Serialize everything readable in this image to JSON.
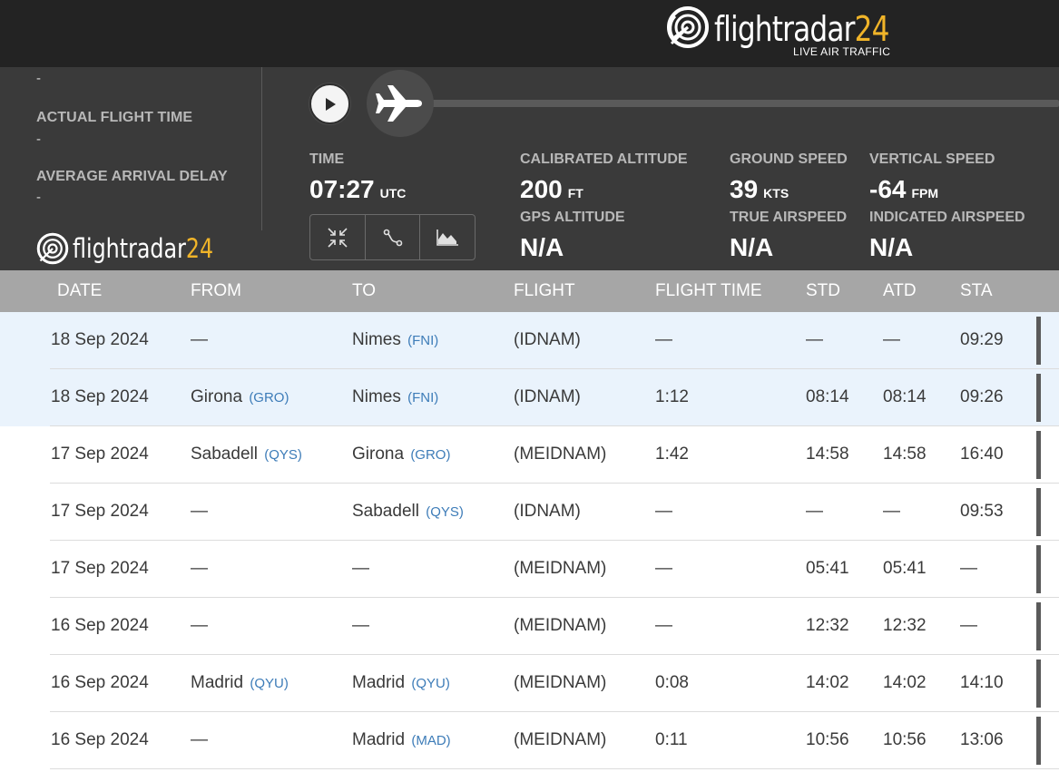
{
  "brand": {
    "name_text": "flightradar",
    "name_number": "24",
    "tagline": "LIVE AIR TRAFFIC"
  },
  "summary": {
    "top_value": "-",
    "actual_flight_time_label": "ACTUAL FLIGHT TIME",
    "actual_flight_time_value": "-",
    "average_arrival_delay_label": "AVERAGE ARRIVAL DELAY",
    "average_arrival_delay_value": "-"
  },
  "playback": {
    "time_label": "TIME",
    "time_value": "07:27",
    "time_unit": "UTC",
    "calibrated_altitude_label": "CALIBRATED ALTITUDE",
    "calibrated_altitude_value": "200",
    "calibrated_altitude_unit": "FT",
    "gps_altitude_label": "GPS ALTITUDE",
    "gps_altitude_value": "N/A",
    "ground_speed_label": "GROUND SPEED",
    "ground_speed_value": "39",
    "ground_speed_unit": "KTS",
    "true_airspeed_label": "TRUE AIRSPEED",
    "true_airspeed_value": "N/A",
    "vertical_speed_label": "VERTICAL SPEED",
    "vertical_speed_value": "-64",
    "vertical_speed_unit": "FPM",
    "indicated_airspeed_label": "INDICATED AIRSPEED",
    "indicated_airspeed_value": "N/A",
    "icons": [
      "play-icon",
      "airplane-icon",
      "collapse-icon",
      "route-icon",
      "chart-icon"
    ]
  },
  "table": {
    "headers": [
      "DATE",
      "FROM",
      "TO",
      "FLIGHT",
      "FLIGHT TIME",
      "STD",
      "ATD",
      "STA"
    ],
    "rows": [
      {
        "date": "18 Sep 2024",
        "from": "—",
        "from_code": "",
        "to": "Nimes",
        "to_code": "(FNI)",
        "flight": "(IDNAM)",
        "flight_time": "—",
        "std": "—",
        "atd": "—",
        "sta": "09:29",
        "highlight": true
      },
      {
        "date": "18 Sep 2024",
        "from": "Girona",
        "from_code": "(GRO)",
        "to": "Nimes",
        "to_code": "(FNI)",
        "flight": "(IDNAM)",
        "flight_time": "1:12",
        "std": "08:14",
        "atd": "08:14",
        "sta": "09:26",
        "highlight": true
      },
      {
        "date": "17 Sep 2024",
        "from": "Sabadell",
        "from_code": "(QYS)",
        "to": "Girona",
        "to_code": "(GRO)",
        "flight": "(MEIDNAM)",
        "flight_time": "1:42",
        "std": "14:58",
        "atd": "14:58",
        "sta": "16:40",
        "highlight": false
      },
      {
        "date": "17 Sep 2024",
        "from": "—",
        "from_code": "",
        "to": "Sabadell",
        "to_code": "(QYS)",
        "flight": "(IDNAM)",
        "flight_time": "—",
        "std": "—",
        "atd": "—",
        "sta": "09:53",
        "highlight": false
      },
      {
        "date": "17 Sep 2024",
        "from": "—",
        "from_code": "",
        "to": "—",
        "to_code": "",
        "flight": "(MEIDNAM)",
        "flight_time": "—",
        "std": "05:41",
        "atd": "05:41",
        "sta": "—",
        "highlight": false
      },
      {
        "date": "16 Sep 2024",
        "from": "—",
        "from_code": "",
        "to": "—",
        "to_code": "",
        "flight": "(MEIDNAM)",
        "flight_time": "—",
        "std": "12:32",
        "atd": "12:32",
        "sta": "—",
        "highlight": false
      },
      {
        "date": "16 Sep 2024",
        "from": "Madrid",
        "from_code": "(QYU)",
        "to": "Madrid",
        "to_code": "(QYU)",
        "flight": "(MEIDNAM)",
        "flight_time": "0:08",
        "std": "14:02",
        "atd": "14:02",
        "sta": "14:10",
        "highlight": false
      },
      {
        "date": "16 Sep 2024",
        "from": "—",
        "from_code": "",
        "to": "Madrid",
        "to_code": "(MAD)",
        "flight": "(MEIDNAM)",
        "flight_time": "0:11",
        "std": "10:56",
        "atd": "10:56",
        "sta": "13:06",
        "highlight": false
      }
    ]
  },
  "colors": {
    "header_bg": "#232323",
    "panel_bg": "#3a3a3a",
    "brand_accent": "#f0b429",
    "table_header_bg": "#a6a6a6",
    "highlight_row_bg": "#eaf3fc",
    "airport_code": "#3d7cb8"
  }
}
